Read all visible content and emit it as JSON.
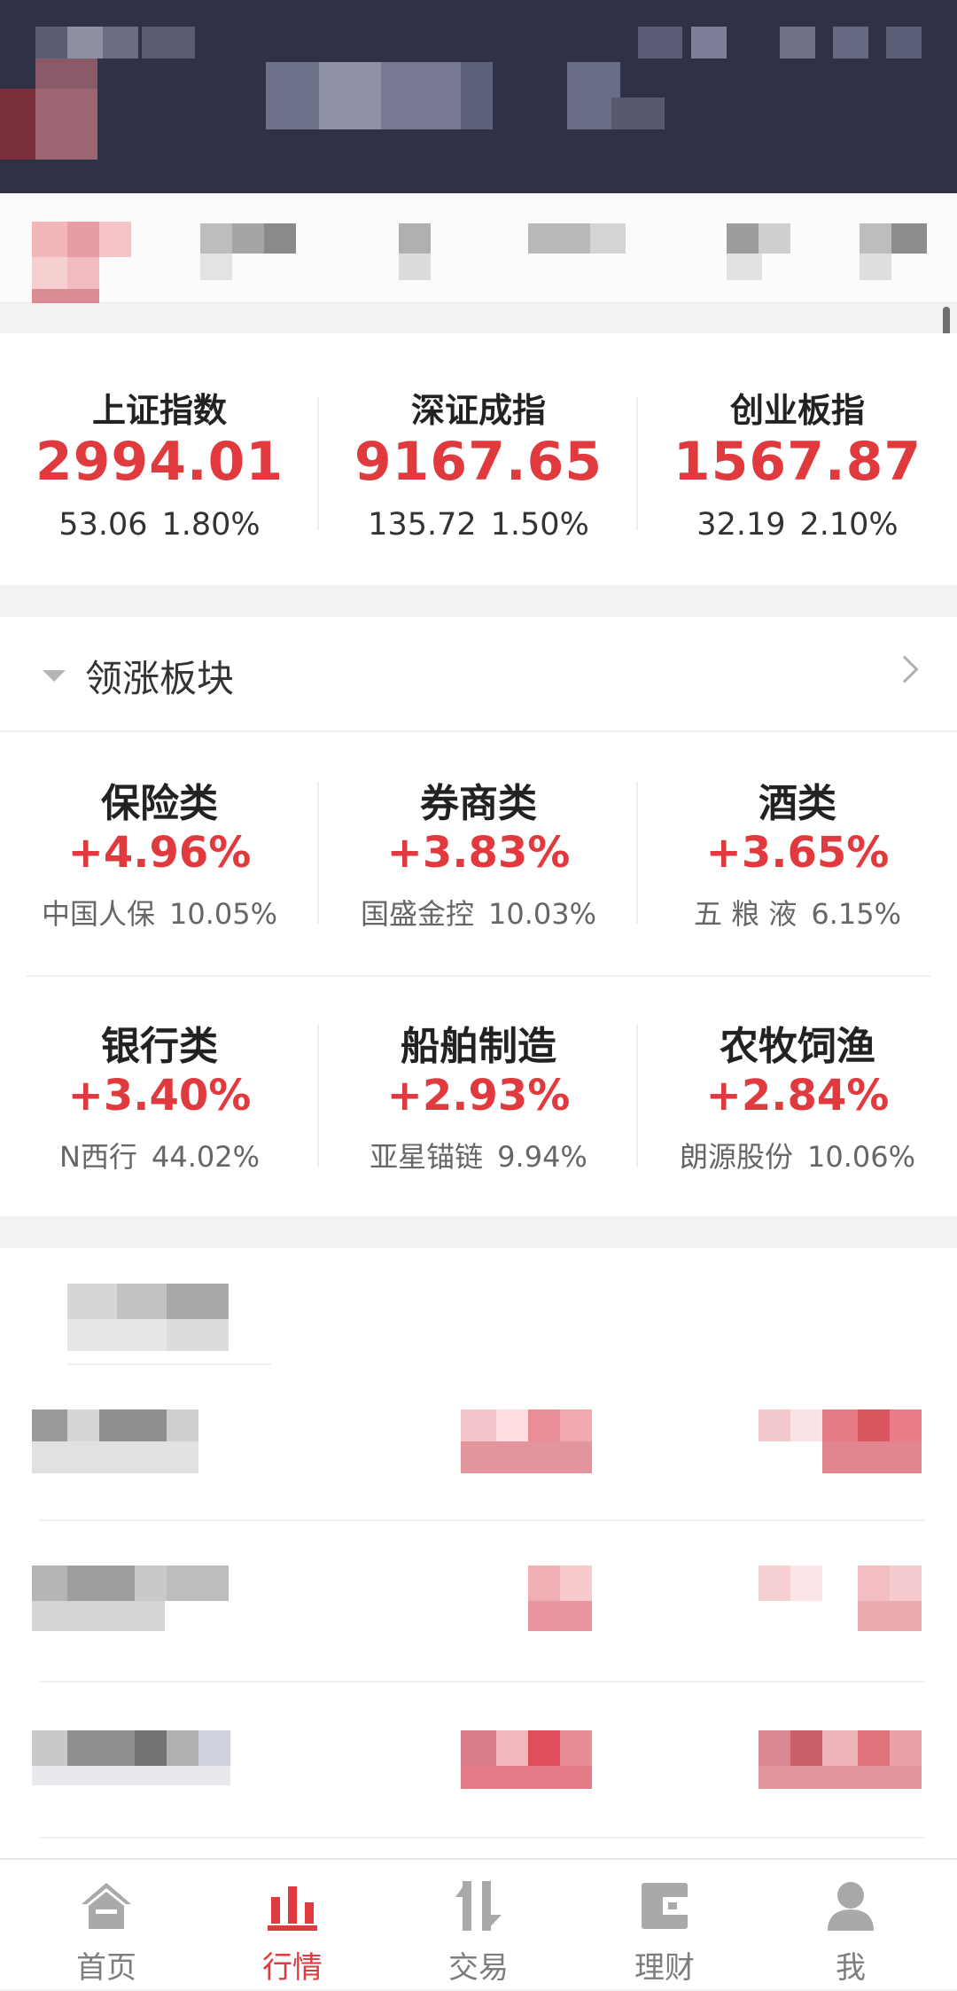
{
  "indices": [
    {
      "name": "上证指数",
      "value": "2994.01",
      "change": "53.06",
      "pct": "1.80%"
    },
    {
      "name": "深证成指",
      "value": "9167.65",
      "change": "135.72",
      "pct": "1.50%"
    },
    {
      "name": "创业板指",
      "value": "1567.87",
      "change": "32.19",
      "pct": "2.10%"
    }
  ],
  "sectors": {
    "title": "领涨板块",
    "items": [
      {
        "name": "保险类",
        "pct": "+4.96%",
        "lead": "中国人保",
        "lead_pct": "10.05%"
      },
      {
        "name": "券商类",
        "pct": "+3.83%",
        "lead": "国盛金控",
        "lead_pct": "10.03%"
      },
      {
        "name": "酒类",
        "pct": "+3.65%",
        "lead": "五 粮 液",
        "lead_pct": "6.15%"
      },
      {
        "name": "银行类",
        "pct": "+3.40%",
        "lead": "N西行",
        "lead_pct": "44.02%"
      },
      {
        "name": "船舶制造",
        "pct": "+2.93%",
        "lead": "亚星锚链",
        "lead_pct": "9.94%"
      },
      {
        "name": "农牧饲渔",
        "pct": "+2.84%",
        "lead": "朗源股份",
        "lead_pct": "10.06%"
      }
    ]
  },
  "colors": {
    "up": "#e03a3f",
    "nav_active": "#e03a3f",
    "nav_inactive": "#a9a9a9"
  },
  "bottom_nav": {
    "items": [
      {
        "label": "首页",
        "icon": "home-icon",
        "active": false
      },
      {
        "label": "行情",
        "icon": "market-chart-icon",
        "active": true
      },
      {
        "label": "交易",
        "icon": "trade-arrows-icon",
        "active": false
      },
      {
        "label": "理财",
        "icon": "wallet-icon",
        "active": false
      },
      {
        "label": "我",
        "icon": "user-icon",
        "active": false
      }
    ]
  }
}
